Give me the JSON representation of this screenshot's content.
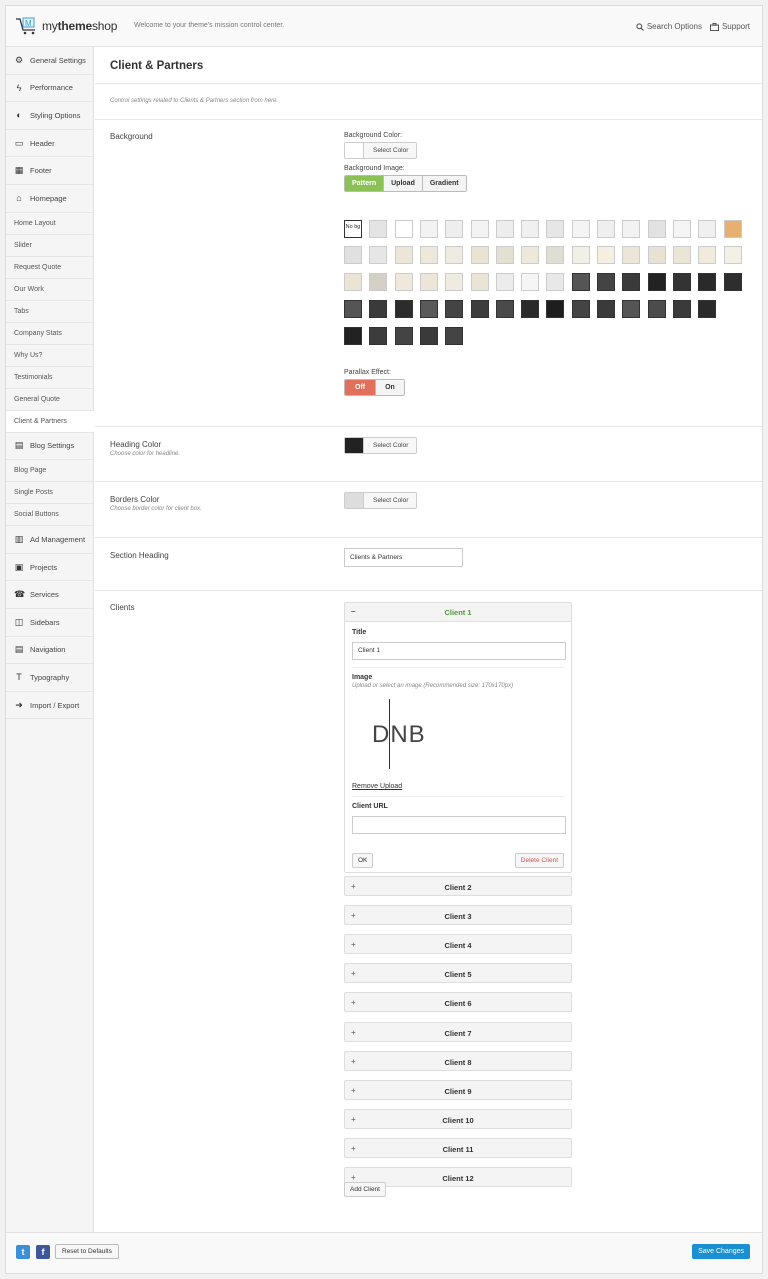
{
  "header": {
    "brand_regular": "my",
    "brand_bold": "theme",
    "brand_tail": "shop",
    "welcome": "Welcome to your theme's mission control center.",
    "search_options": "Search Options",
    "support": "Support"
  },
  "sidebar": {
    "items": [
      {
        "label": "General Settings",
        "icon": "gears-icon"
      },
      {
        "label": "Performance",
        "icon": "lightning-icon"
      },
      {
        "label": "Styling Options",
        "icon": "contrast-icon"
      },
      {
        "label": "Header",
        "icon": "header-icon"
      },
      {
        "label": "Footer",
        "icon": "table-icon"
      },
      {
        "label": "Homepage",
        "icon": "home-icon"
      },
      {
        "label": "Home Layout"
      },
      {
        "label": "Slider"
      },
      {
        "label": "Request Quote"
      },
      {
        "label": "Our Work"
      },
      {
        "label": "Tabs"
      },
      {
        "label": "Company Stats"
      },
      {
        "label": "Why Us?"
      },
      {
        "label": "Testimonials"
      },
      {
        "label": "General Quote"
      },
      {
        "label": "Client & Partners"
      },
      {
        "label": "Blog Settings",
        "icon": "document-icon"
      },
      {
        "label": "Blog Page"
      },
      {
        "label": "Single Posts"
      },
      {
        "label": "Social Buttons"
      },
      {
        "label": "Ad Management",
        "icon": "bar-chart-icon"
      },
      {
        "label": "Projects",
        "icon": "clipboard-icon"
      },
      {
        "label": "Services",
        "icon": "phone-icon"
      },
      {
        "label": "Sidebars",
        "icon": "columns-icon"
      },
      {
        "label": "Navigation",
        "icon": "menu-icon"
      },
      {
        "label": "Typography",
        "icon": "text-icon"
      },
      {
        "label": "Import / Export",
        "icon": "import-icon"
      }
    ]
  },
  "main": {
    "title": "Client & Partners",
    "description": "Control settings related to Clients & Partners section from here.",
    "background": {
      "label": "Background",
      "color_label": "Background Color:",
      "select_color": "Select Color",
      "image_label": "Background Image:",
      "image_tabs": [
        "Pattern",
        "Upload",
        "Gradient"
      ],
      "no_bg": "No bg",
      "parallax_label": "Parallax Effect:",
      "parallax_options": [
        "Off",
        "On"
      ]
    },
    "heading_color": {
      "label": "Heading Color",
      "hint": "Choose color for headline.",
      "select_color": "Select Color",
      "color": "#222222"
    },
    "borders_color": {
      "label": "Borders Color",
      "hint": "Choose border color for client box.",
      "select_color": "Select Color",
      "color": "#dddddd"
    },
    "section_heading": {
      "label": "Section Heading",
      "value": "Clients & Partners"
    },
    "clients": {
      "label": "Clients",
      "open_client": {
        "name": "Client 1",
        "title_label": "Title",
        "title_value": "Client 1",
        "image_label": "Image",
        "image_hint": "Upload or select an image.(Recommended size: 170x170px)",
        "logo_text": "DNB",
        "remove_upload": "Remove Upload",
        "url_label": "Client URL",
        "url_value": "",
        "ok": "OK",
        "delete": "Delete Client"
      },
      "collapsed": [
        "Client 2",
        "Client 3",
        "Client 4",
        "Client 5",
        "Client 6",
        "Client 7",
        "Client 8",
        "Client 9",
        "Client 10",
        "Client 11",
        "Client 12"
      ],
      "add_client": "Add Client"
    }
  },
  "footer": {
    "reset": "Reset to Defaults",
    "save": "Save Changes"
  },
  "colors": {
    "green": "#8cc155",
    "red": "#e0705b",
    "blue": "#1a8fd1",
    "twitter": "#3a8fd6",
    "facebook": "#3b5998"
  }
}
